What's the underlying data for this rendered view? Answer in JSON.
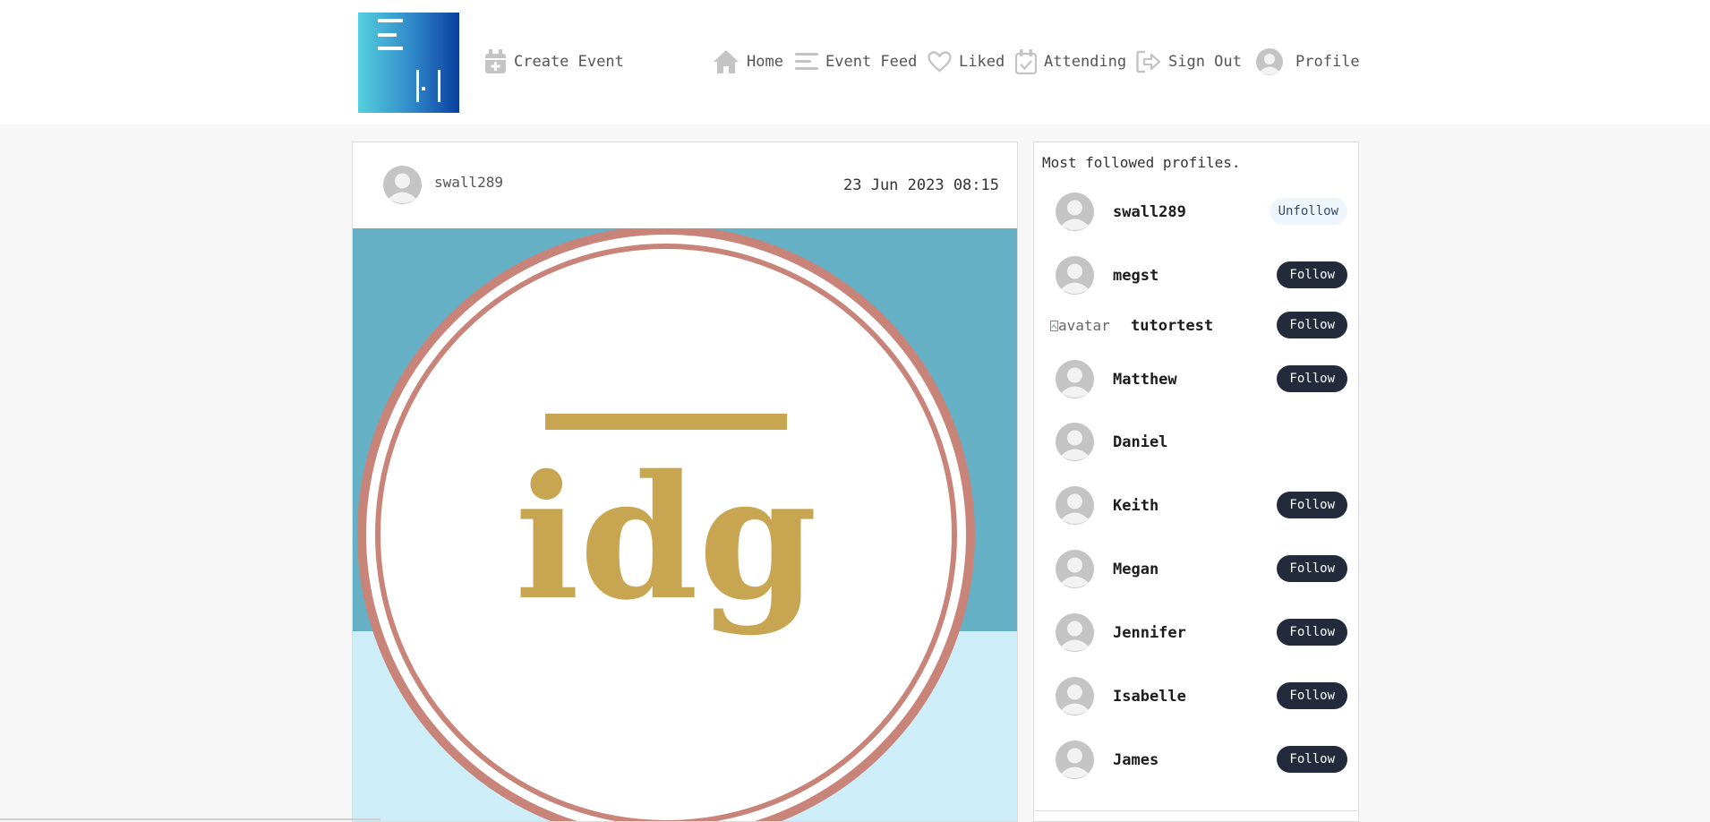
{
  "nav": {
    "create_event": "Create Event",
    "home": "Home",
    "event_feed": "Event Feed",
    "liked": "Liked",
    "attending": "Attending",
    "sign_out": "Sign Out",
    "profile": "Profile"
  },
  "post": {
    "username": "swall289",
    "date": "23 Jun 2023 08:15",
    "image_text": "idg"
  },
  "sidebar": {
    "title": "Most followed profiles.",
    "profiles": [
      {
        "name": "swall289",
        "button": "Unfollow"
      },
      {
        "name": "megst",
        "button": "Follow"
      },
      {
        "name": "tutortest",
        "button": "Follow",
        "alt": "avatar"
      },
      {
        "name": "Matthew",
        "button": "Follow"
      },
      {
        "name": "Daniel",
        "button": ""
      },
      {
        "name": "Keith",
        "button": "Follow"
      },
      {
        "name": "Megan",
        "button": "Follow"
      },
      {
        "name": "Jennifer",
        "button": "Follow"
      },
      {
        "name": "Isabelle",
        "button": "Follow"
      },
      {
        "name": "James",
        "button": "Follow"
      }
    ]
  },
  "colors": {
    "accent_dark": "#232a3b",
    "unfollow_bg": "#eef6fb",
    "icon_gray": "#c4c4c4",
    "ring": "#c98479",
    "gold": "#c8a551",
    "image_top": "#65b0c5",
    "image_bottom": "#cdeef8"
  }
}
